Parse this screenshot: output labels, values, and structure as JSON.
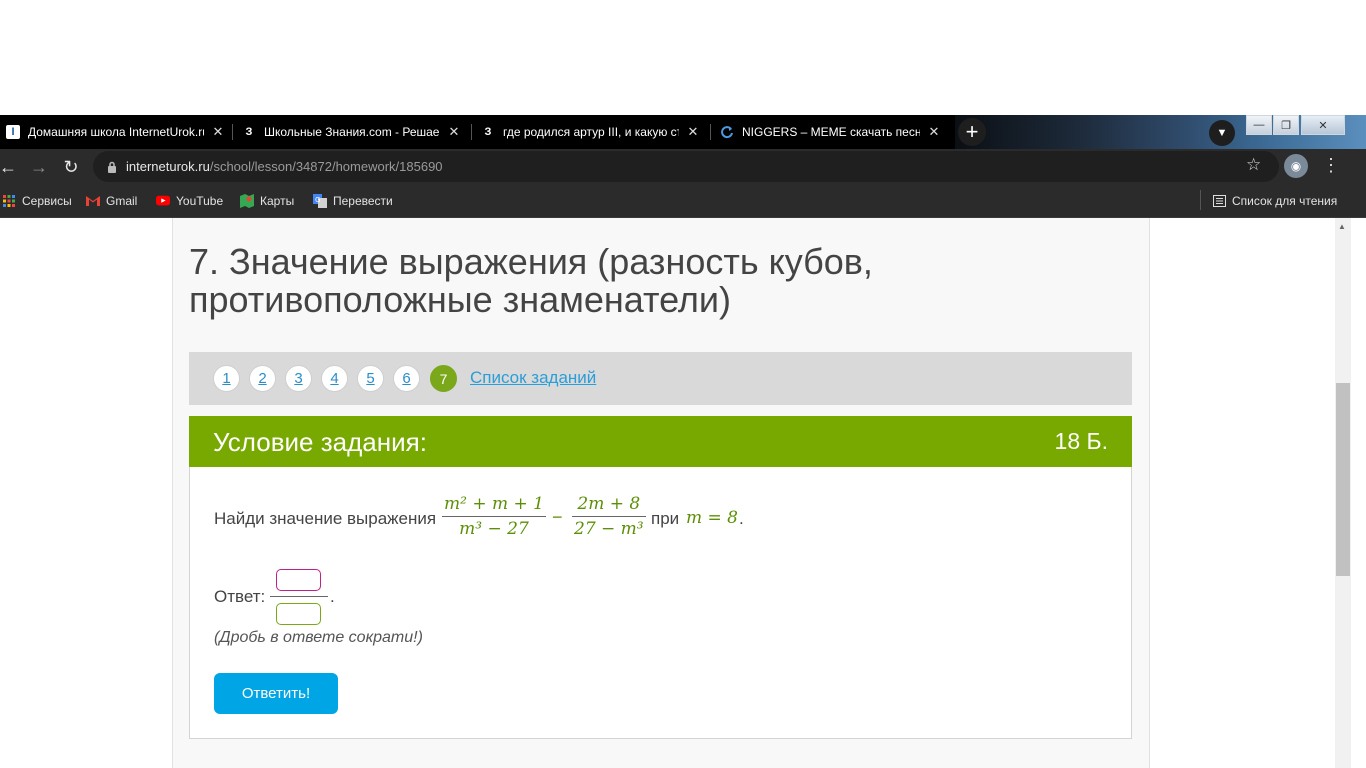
{
  "browser": {
    "tabs": [
      {
        "title": "Домашняя школа InternetUrok.ru",
        "favicon": "I"
      },
      {
        "title": "Школьные Знания.com - Решаем",
        "favicon": "З"
      },
      {
        "title": "где родился артур III, и какую стр",
        "favicon": "З"
      },
      {
        "title": "NIGGERS – MEME скачать песню",
        "favicon": "C"
      }
    ],
    "address": {
      "host": "interneturok.ru",
      "path": "/school/lesson/34872/homework/185690"
    },
    "bookmarks": [
      "Сервисы",
      "Gmail",
      "YouTube",
      "Карты",
      "Перевести"
    ],
    "reading_list": "Список для чтения"
  },
  "lesson": {
    "title": "7. Значение выражения (разность кубов, противоположные знаменатели)",
    "pages": [
      "1",
      "2",
      "3",
      "4",
      "5",
      "6",
      "7"
    ],
    "current_page": "7",
    "task_list_link": "Список заданий"
  },
  "task": {
    "header": "Условие задания:",
    "points": "18 Б.",
    "question_prefix": "Найди значение выражения",
    "frac1_num": "m² + m + 1",
    "frac1_den": "m³ − 27",
    "minus": "−",
    "frac2_num": "2m + 8",
    "frac2_den": "27 − m³",
    "question_at": "при",
    "condition": "m = 8",
    "answer_label": "Ответ:",
    "hint": "(Дробь в ответе сократи!)",
    "submit_label": "Ответить!"
  },
  "colors": {
    "accent_green": "#77a900",
    "math_green": "#5d8f06",
    "submit_blue": "#00a5e6",
    "link_blue": "#2a9ed8"
  }
}
